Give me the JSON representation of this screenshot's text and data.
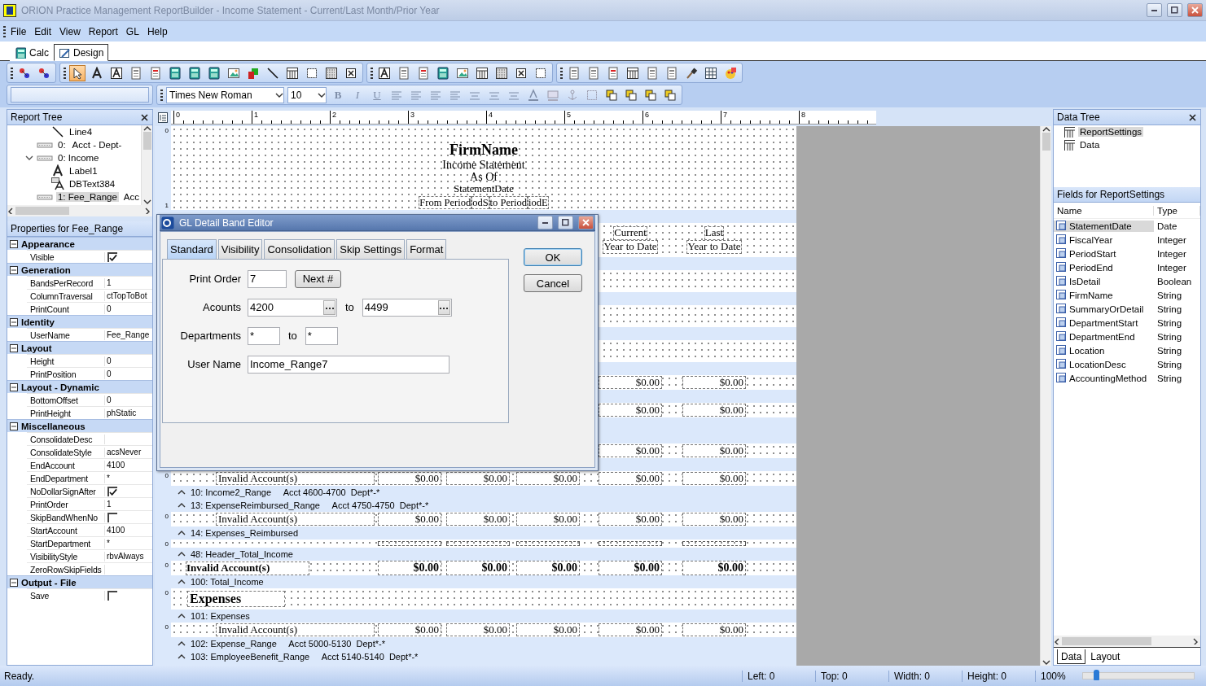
{
  "window": {
    "title": "ORION Practice Management ReportBuilder - Income Statement - Current/Last Month/Prior Year"
  },
  "menu": [
    "File",
    "Edit",
    "View",
    "Report",
    "GL",
    "Help"
  ],
  "tabs": [
    {
      "label": "Calc",
      "selected": false
    },
    {
      "label": "Design",
      "selected": true
    }
  ],
  "toolbar": {
    "pointer_selected": true,
    "font": "Times New Roman",
    "size": "10",
    "format_buttons": [
      "B",
      "I",
      "U"
    ]
  },
  "report_tree": {
    "title": "Report Tree",
    "items": [
      {
        "kind": "group",
        "children": [
          {
            "kind": "line",
            "label": "Line4",
            "selected": false
          }
        ]
      },
      {
        "kind": "band",
        "label": "0:",
        "detail": "Acct -  Dept-",
        "selected": false
      },
      {
        "kind": "band",
        "label": "0: Income",
        "expanded": true,
        "selected": false,
        "children": [
          {
            "kind": "label",
            "label": "Label1",
            "selected": false
          },
          {
            "kind": "dbtext",
            "label": "DBText384",
            "selected": false
          }
        ]
      },
      {
        "kind": "band",
        "label": "1: Fee_Range",
        "detail": "Acc",
        "selected": true
      }
    ]
  },
  "properties": {
    "title": "Properties for Fee_Range",
    "categories": [
      {
        "name": "Appearance",
        "expanded": true,
        "rows": [
          {
            "name": "Visible",
            "kind": "check",
            "checked": true
          }
        ]
      },
      {
        "name": "Generation",
        "expanded": true,
        "rows": [
          {
            "name": "BandsPerRecord",
            "kind": "text",
            "value": "1"
          },
          {
            "name": "ColumnTraversal",
            "kind": "text",
            "value": "ctTopToBot"
          },
          {
            "name": "PrintCount",
            "kind": "text",
            "value": "0"
          }
        ]
      },
      {
        "name": "Identity",
        "expanded": true,
        "rows": [
          {
            "name": "UserName",
            "kind": "text",
            "value": "Fee_Range"
          }
        ]
      },
      {
        "name": "Layout",
        "expanded": true,
        "rows": [
          {
            "name": "Height",
            "kind": "text",
            "value": "0"
          },
          {
            "name": "PrintPosition",
            "kind": "text",
            "value": "0"
          }
        ]
      },
      {
        "name": "Layout - Dynamic",
        "expanded": true,
        "rows": [
          {
            "name": "BottomOffset",
            "kind": "text",
            "value": "0"
          },
          {
            "name": "PrintHeight",
            "kind": "text",
            "value": "phStatic"
          }
        ]
      },
      {
        "name": "Miscellaneous",
        "expanded": true,
        "rows": [
          {
            "name": "ConsolidateDesc",
            "kind": "text"
          },
          {
            "name": "ConsolidateStyle",
            "kind": "text",
            "value": "acsNever"
          },
          {
            "name": "EndAccount",
            "kind": "text",
            "value": "4100"
          },
          {
            "name": "EndDepartment",
            "kind": "text",
            "value": "*"
          },
          {
            "name": "NoDollarSignAfter",
            "kind": "check",
            "checked": true
          },
          {
            "name": "PrintOrder",
            "kind": "text",
            "value": "1"
          },
          {
            "name": "SkipBandWhenNo",
            "kind": "check",
            "checked": false
          },
          {
            "name": "StartAccount",
            "kind": "text",
            "value": "4100"
          },
          {
            "name": "StartDepartment",
            "kind": "text",
            "value": "*"
          },
          {
            "name": "VisibilityStyle",
            "kind": "text",
            "value": "rbvAlways"
          },
          {
            "name": "ZeroRowSkipFields",
            "kind": "text"
          }
        ]
      },
      {
        "name": "Output - File",
        "expanded": true,
        "rows": [
          {
            "name": "Save",
            "kind": "check",
            "checked": false
          }
        ]
      }
    ]
  },
  "ruler_marks": [
    "0",
    "1",
    "2",
    "3",
    "4",
    "5",
    "6",
    "7",
    "8"
  ],
  "bands": [
    {
      "kind": "header",
      "marks": [
        "0",
        "1"
      ],
      "title": "FirmName",
      "lines": [
        "Income Statement",
        "As Of",
        "StatementDate"
      ],
      "period": [
        "From Period",
        "odS",
        "to Period",
        "iodE"
      ]
    },
    {
      "kind": "label"
    },
    {
      "kind": "columns",
      "headings": [
        {
          "top": "Current",
          "bottom": "Year to Date"
        },
        {
          "top": "Last",
          "bottom": "Year to Date"
        }
      ]
    },
    {
      "kind": "label"
    },
    {
      "kind": "blank"
    },
    {
      "kind": "label"
    },
    {
      "kind": "blank"
    },
    {
      "kind": "label"
    },
    {
      "kind": "blank"
    },
    {
      "kind": "label"
    },
    {
      "kind": "detail",
      "amounts": [
        "$0.00",
        "$0.00"
      ]
    },
    {
      "kind": "label"
    },
    {
      "kind": "detail",
      "amounts": [
        "$0.00",
        "$0.00"
      ]
    },
    {
      "kind": "label"
    },
    {
      "kind": "label"
    },
    {
      "kind": "detail",
      "amounts": [
        "$0.00",
        "$0.00"
      ]
    },
    {
      "kind": "label"
    },
    {
      "kind": "detail",
      "marks": [
        "0"
      ],
      "account": "Invalid Account(s)",
      "amounts": [
        "$0.00",
        "$0.00",
        "$0.00",
        "$0.00",
        "$0.00"
      ]
    },
    {
      "kind": "label",
      "title": "10: Income2_Range",
      "detail": "Acct 4600-4700  Dept*-*"
    },
    {
      "kind": "label",
      "title": "13: ExpenseReimbursed_Range",
      "detail": "Acct 4750-4750  Dept*-*"
    },
    {
      "kind": "detail",
      "marks": [
        "0"
      ],
      "account": "Invalid Account(s)",
      "amounts": [
        "$0.00",
        "$0.00",
        "$0.00",
        "$0.00",
        "$0.00"
      ]
    },
    {
      "kind": "label",
      "title": "14: Expenses_Reimbursed"
    },
    {
      "kind": "rule",
      "marks": [
        "0"
      ]
    },
    {
      "kind": "label",
      "title": "48: Header_Total_Income"
    },
    {
      "kind": "total",
      "marks": [
        "0"
      ],
      "account": "Invalid Account(s)",
      "amounts": [
        "$0.00",
        "$0.00",
        "$0.00",
        "$0.00",
        "$0.00"
      ]
    },
    {
      "kind": "label",
      "title": "100: Total_Income"
    },
    {
      "kind": "section",
      "marks": [
        "0"
      ],
      "title": "Expenses"
    },
    {
      "kind": "label",
      "title": "101: Expenses"
    },
    {
      "kind": "detail",
      "marks": [
        "0"
      ],
      "account": "Invalid Account(s)",
      "amounts": [
        "$0.00",
        "$0.00",
        "$0.00",
        "$0.00",
        "$0.00"
      ]
    },
    {
      "kind": "label",
      "title": "102: Expense_Range",
      "detail": "Acct 5000-5130  Dept*-*"
    },
    {
      "kind": "label",
      "title": "103: EmployeeBenefit_Range",
      "detail": "Acct 5140-5140  Dept*-*"
    }
  ],
  "dialog": {
    "title": "GL Detail Band Editor",
    "tabs": [
      {
        "label": "Standard",
        "selected": true
      },
      {
        "label": "Visibility",
        "selected": false
      },
      {
        "label": "Consolidation",
        "selected": false
      },
      {
        "label": "Skip Settings",
        "selected": false
      },
      {
        "label": "Format",
        "selected": false
      }
    ],
    "buttons": [
      "OK",
      "Cancel"
    ],
    "print_order": {
      "label": "Print Order",
      "value": "7",
      "button": "Next #"
    },
    "accounts": {
      "label": "Acounts",
      "from": "4200",
      "to_label": "to",
      "to": "4499"
    },
    "departments": {
      "label": "Departments",
      "from": "*",
      "to_label": "to",
      "to": "*"
    },
    "user_name": {
      "label": "User Name",
      "value": "Income_Range7"
    }
  },
  "data_tree": {
    "title": "Data Tree",
    "items": [
      {
        "label": "ReportSettings",
        "selected": true
      },
      {
        "label": "Data",
        "selected": false
      }
    ]
  },
  "fields": {
    "title": "Fields for ReportSettings",
    "columns": [
      "Name",
      "Type"
    ],
    "rows": [
      {
        "name": "StatementDate",
        "type": "Date",
        "selected": true
      },
      {
        "name": "FiscalYear",
        "type": "Integer",
        "selected": false
      },
      {
        "name": "PeriodStart",
        "type": "Integer",
        "selected": false
      },
      {
        "name": "PeriodEnd",
        "type": "Integer",
        "selected": false
      },
      {
        "name": "IsDetail",
        "type": "Boolean",
        "selected": false
      },
      {
        "name": "FirmName",
        "type": "String",
        "selected": false
      },
      {
        "name": "SummaryOrDetail",
        "type": "String",
        "selected": false
      },
      {
        "name": "DepartmentStart",
        "type": "String",
        "selected": false
      },
      {
        "name": "DepartmentEnd",
        "type": "String",
        "selected": false
      },
      {
        "name": "Location",
        "type": "String",
        "selected": false
      },
      {
        "name": "LocationDesc",
        "type": "String",
        "selected": false
      },
      {
        "name": "AccountingMethod",
        "type": "String",
        "selected": false
      }
    ]
  },
  "bottom_tabs": [
    {
      "label": "Data",
      "selected": true
    },
    {
      "label": "Layout",
      "selected": false
    }
  ],
  "status_bar": {
    "message": "Ready.",
    "items": [
      "Left: 0",
      "Top: 0",
      "Width: 0",
      "Height: 0"
    ],
    "zoom": "100%",
    "zoom_slider": {
      "level": 0.12
    }
  }
}
